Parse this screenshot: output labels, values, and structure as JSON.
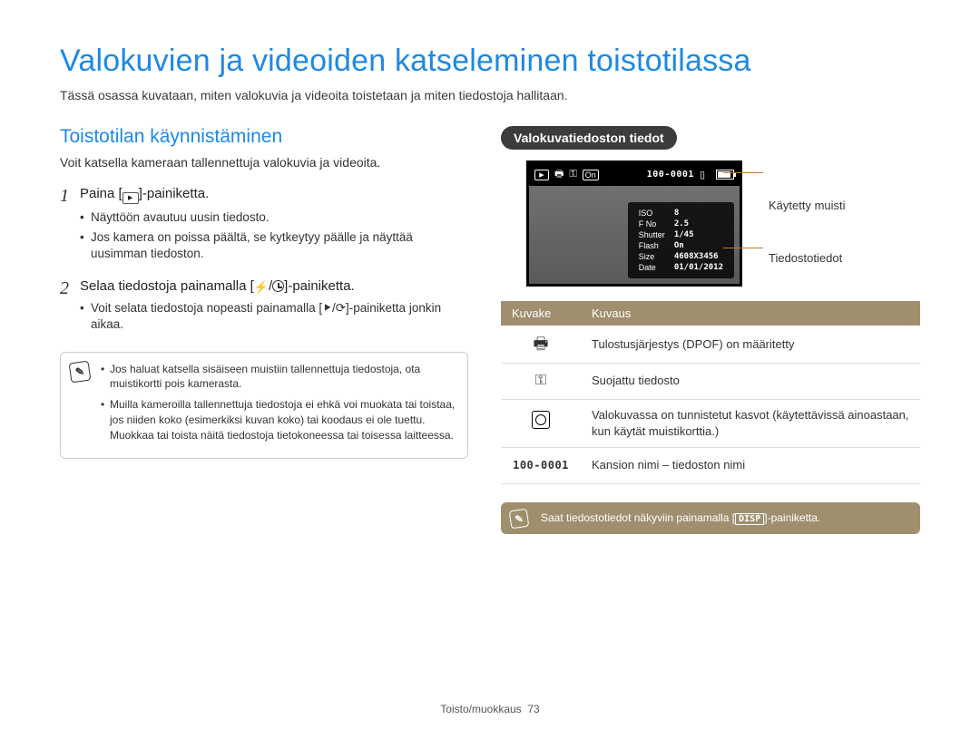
{
  "title": "Valokuvien ja videoiden katseleminen toistotilassa",
  "subtitle": "Tässä osassa kuvataan, miten valokuvia ja videoita toistetaan ja miten tiedostoja hallitaan.",
  "section_heading": "Toistotilan käynnistäminen",
  "section_intro": "Voit katsella kameraan tallennettuja valokuvia ja videoita.",
  "steps": [
    {
      "num": "1",
      "line_pre": "Paina [",
      "line_post": "]-painiketta.",
      "bullets": [
        "Näyttöön avautuu uusin tiedosto.",
        "Jos kamera on poissa päältä, se kytkeytyy päälle ja näyttää uusimman tiedoston."
      ]
    },
    {
      "num": "2",
      "line_pre": "Selaa tiedostoja painamalla [",
      "line_post": "]-painiketta.",
      "bullets": [
        "Voit selata tiedostoja nopeasti painamalla [⯈/⟳]-painiketta jonkin aikaa."
      ]
    }
  ],
  "note_items": [
    "Jos haluat katsella sisäiseen muistiin tallennettuja tiedostoja, ota muistikortti pois kamerasta.",
    "Muilla kameroilla tallennettuja tiedostoja ei ehkä voi muokata tai toistaa, jos niiden koko (esimerkiksi kuvan koko) tai koodaus ei ole tuettu. Muokkaa tai toista näitä tiedostoja tietokoneessa tai toisessa laitteessa."
  ],
  "pill_label": "Valokuvatiedoston tiedot",
  "screen": {
    "folder_file": "100-0001",
    "on_label": "On",
    "info": {
      "ISO": "8",
      "F No": "2.5",
      "Shutter": "1/45",
      "Flash": "On",
      "Size": "4608X3456",
      "Date": "01/01/2012"
    }
  },
  "callouts": {
    "memory": "Käytetty muisti",
    "fileinfo": "Tiedostotiedot"
  },
  "legend": {
    "head_icon": "Kuvake",
    "head_desc": "Kuvaus",
    "rows": [
      {
        "kind": "print",
        "desc": "Tulostusjärjestys (DPOF) on määritetty"
      },
      {
        "kind": "key",
        "desc": "Suojattu tiedosto"
      },
      {
        "kind": "face",
        "desc": "Valokuvassa on tunnistetut kasvot (käytettävissä ainoastaan, kun käytät muistikorttia.)"
      },
      {
        "kind": "folder",
        "label": "100-0001",
        "desc": "Kansion nimi – tiedoston nimi"
      }
    ]
  },
  "tip": {
    "pre": "Saat tiedostotiedot näkyviin painamalla [",
    "btn": "DISP",
    "post": "]-painiketta."
  },
  "footer": {
    "section": "Toisto/muokkaus",
    "page": "73"
  }
}
